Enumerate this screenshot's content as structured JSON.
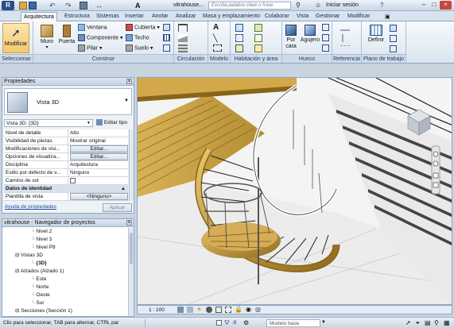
{
  "title": {
    "file": "vitrahouse...",
    "search_placeholder": "Escriba palabra clave o frase",
    "user": "Iniciar sesión"
  },
  "tabs": [
    "Arquitectura",
    "Estructura",
    "Sistemas",
    "Insertar",
    "Anotar",
    "Analizar",
    "Masa y emplazamiento",
    "Colaborar",
    "Vista",
    "Gestionar",
    "Modificar"
  ],
  "ribbon": {
    "modificar": "Modificar",
    "muro": "Muro",
    "puerta": "Puerta",
    "ventana": "Ventana",
    "componente": "Componente",
    "pilar": "Pilar",
    "cubierta": "Cubierta",
    "techo": "Techo",
    "suelo": "Suelo",
    "porcara": "Por cara",
    "agujero": "Agujero",
    "definir": "Definir",
    "panels": {
      "seleccionar": "Seleccionar",
      "construir": "Construir",
      "circulacion": "Circulación",
      "modelo": "Modelo",
      "habitacion": "Habitación y área",
      "hueco": "Hueco",
      "referencia": "Referencia",
      "plano": "Plano de trabajo"
    }
  },
  "properties": {
    "title": "Propiedades",
    "type_name": "Vista 3D",
    "selector": "Vista 3D: {3D}",
    "edit_type": "Editar tipo",
    "rows": [
      {
        "k": "Nivel de detalle",
        "v": "Alto",
        "btn": false
      },
      {
        "k": "Visibilidad de piezas",
        "v": "Mostrar original",
        "btn": false
      },
      {
        "k": "Modificaciones de visi...",
        "v": "Editar...",
        "btn": true
      },
      {
        "k": "Opciones de visualiza...",
        "v": "Editar...",
        "btn": true
      },
      {
        "k": "Disciplina",
        "v": "Arquitectura",
        "btn": false
      },
      {
        "k": "Estilo por defecto de v...",
        "v": "Ninguno",
        "btn": false
      },
      {
        "k": "Camino de sol",
        "v": "",
        "btn": false
      }
    ],
    "section": "Datos de identidad",
    "plantilla_k": "Plantilla de vista",
    "plantilla_v": "<Ninguno>",
    "help": "Ayuda de propiedades",
    "apply": "Aplicar"
  },
  "browser": {
    "title": "vitrahouse - Navegador de proyectos",
    "items": [
      {
        "label": "Nivel 2",
        "indent": 3
      },
      {
        "label": "Nivel 3",
        "indent": 3
      },
      {
        "label": "Nivel P8",
        "indent": 3
      },
      {
        "label": "Vistas 3D",
        "indent": 1
      },
      {
        "label": "{3D}",
        "indent": 3
      },
      {
        "label": "Alzados (Alzado 1)",
        "indent": 1
      },
      {
        "label": "Este",
        "indent": 3
      },
      {
        "label": "Norte",
        "indent": 3
      },
      {
        "label": "Oeste",
        "indent": 3
      },
      {
        "label": "Sur",
        "indent": 3
      },
      {
        "label": "Secciones (Sección 1)",
        "indent": 1
      }
    ]
  },
  "viewbar": {
    "scale": "1 : 100"
  },
  "status": {
    "text": "Clic para seleccionar, TAB para alternar, CTRL par",
    "zero": ":0",
    "model": "Modelo base"
  }
}
